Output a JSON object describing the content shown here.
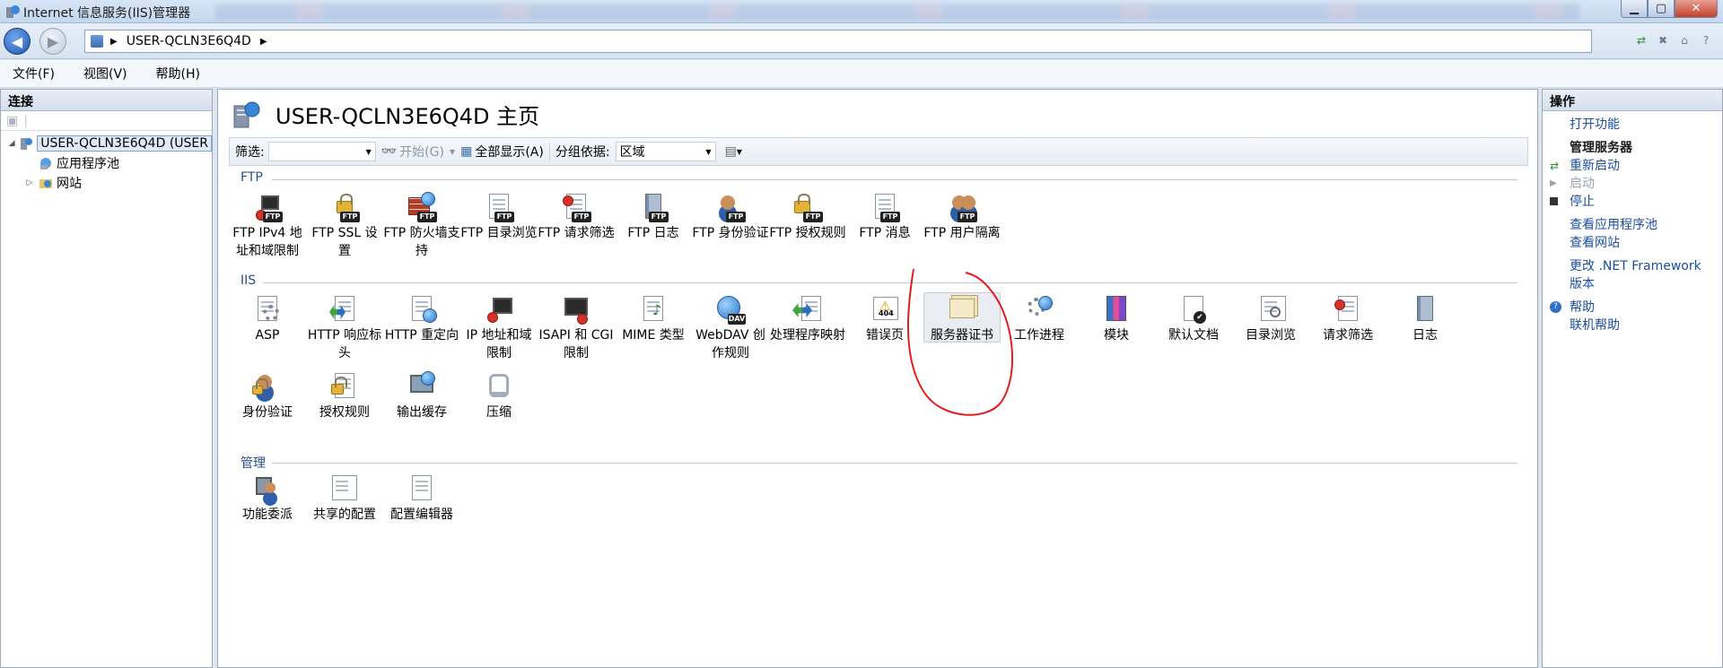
{
  "window": {
    "title": "Internet 信息服务(IIS)管理器"
  },
  "address": {
    "path": "USER-QCLN3E6Q4D"
  },
  "menu": [
    "文件(F)",
    "视图(V)",
    "帮助(H)"
  ],
  "connections": {
    "header": "连接",
    "server": "USER-QCLN3E6Q4D (USER",
    "app_pools": "应用程序池",
    "sites": "网站"
  },
  "main": {
    "title": "USER-QCLN3E6Q4D 主页",
    "filter_label": "筛选:",
    "filter_value": "",
    "start_label": "开始(G)",
    "show_all_label": "全部显示(A)",
    "group_by_label": "分组依据:",
    "group_by_value": "区域",
    "sections": {
      "ftp": "FTP",
      "iis": "IIS",
      "mgmt": "管理"
    },
    "ftp_features": [
      "FTP IPv4 地址和域限制",
      "FTP SSL 设置",
      "FTP 防火墙支持",
      "FTP 目录浏览",
      "FTP 请求筛选",
      "FTP 日志",
      "FTP 身份验证",
      "FTP 授权规则",
      "FTP 消息",
      "FTP 用户隔离"
    ],
    "iis_features": [
      "ASP",
      "HTTP 响应标头",
      "HTTP 重定向",
      "IP 地址和域限制",
      "ISAPI 和 CGI 限制",
      "MIME 类型",
      "WebDAV 创作规则",
      "处理程序映射",
      "错误页",
      "服务器证书",
      "工作进程",
      "模块",
      "默认文档",
      "目录浏览",
      "请求筛选",
      "日志",
      "身份验证",
      "授权规则",
      "输出缓存",
      "压缩"
    ],
    "mgmt_features": [
      "功能委派",
      "共享的配置",
      "配置编辑器"
    ]
  },
  "actions": {
    "header": "操作",
    "open_feature": "打开功能",
    "manage_server": "管理服务器",
    "restart": "重新启动",
    "start": "启动",
    "stop": "停止",
    "view_app_pools": "查看应用程序池",
    "view_sites": "查看网站",
    "change_framework_1": "更改 .NET Framework",
    "change_framework_2": "版本",
    "help": "帮助",
    "online_help": "联机帮助"
  },
  "colors": {
    "link": "#1b4f9c",
    "section": "#2b4f86",
    "annotation_circle": "#e01e1e"
  }
}
